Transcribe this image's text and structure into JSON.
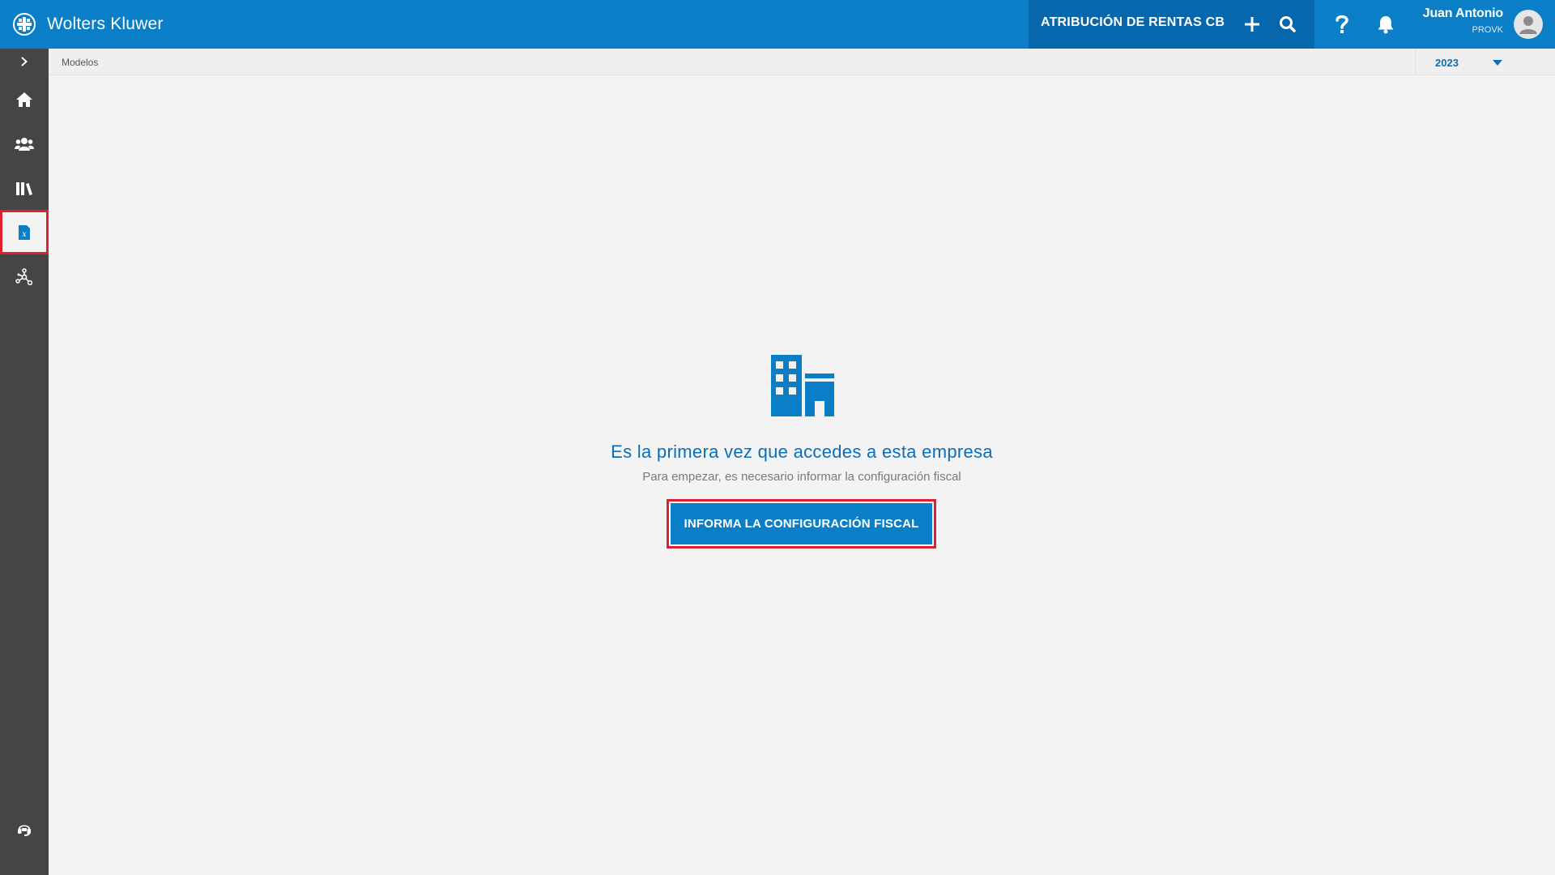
{
  "header": {
    "brand_name": "Wolters Kluwer",
    "company_name": "ATRIBUCIÓN DE RENTAS CB",
    "user_name": "Juan Antonio",
    "user_code": "PROVK",
    "icons": [
      "wolters-kluwer-logo",
      "plus-icon",
      "search-icon",
      "help-icon",
      "bell-icon",
      "avatar-icon"
    ]
  },
  "sidebar": {
    "items": [
      {
        "icon": "chevron-right-icon"
      },
      {
        "icon": "home-icon"
      },
      {
        "icon": "users-icon"
      },
      {
        "icon": "library-icon"
      },
      {
        "icon": "tax-models-icon",
        "active": true
      },
      {
        "icon": "network-icon"
      },
      {
        "icon": "support-icon"
      }
    ]
  },
  "breadcrumb": {
    "current": "Modelos"
  },
  "year_selector": {
    "value": "2023"
  },
  "empty_state": {
    "icon": "building-icon",
    "title": "Es la primera vez que accedes a esta empresa",
    "subtitle": "Para empezar, es necesario informar la configuración fiscal",
    "button_label": "INFORMA LA CONFIGURACIÓN FISCAL"
  },
  "colors": {
    "header_blue": "#0a7fc8",
    "company_blue": "#0667ad",
    "sidebar_dark": "#454545",
    "highlight_red": "#e0202f",
    "text_blue": "#0a6fb8"
  }
}
